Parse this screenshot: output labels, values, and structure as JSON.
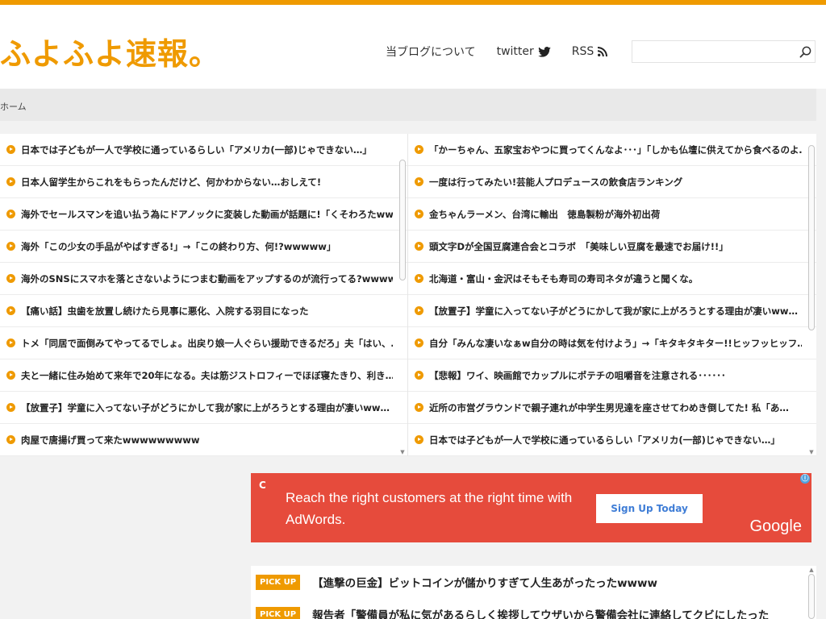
{
  "site": {
    "title": "ふよふよ速報。"
  },
  "colors": {
    "accent": "#ef9a00",
    "ad_background": "#e64b3c",
    "ad_button_text": "#3f7dd6"
  },
  "nav": {
    "about": "当ブログについて",
    "twitter": "twitter",
    "rss": "RSS",
    "search_placeholder": ""
  },
  "breadcrumb": {
    "home": "ホーム"
  },
  "feeds": {
    "left": [
      "日本では子どもが一人で学校に通っているらしい「アメリカ(一部)じゃできない…」",
      "日本人留学生からこれをもらったんだけど、何かわからない…おしえて!",
      "海外でセールスマンを追い払う為にドアノックに変装した動画が話題に!「くそわろたwww",
      "海外「この少女の手品がやばすぎる!」→「この終わり方、何!?wwwww」",
      "海外のSNSにスマホを落とさないようにつまむ動画をアップするのが流行ってる?wwww",
      "【痛い話】虫歯を放置し続けたら見事に悪化、入院する羽目になった",
      "トメ「同居で面倒みてやってるでしょ。出戻り娘一人ぐらい援助できるだろ」夫「はい、…",
      "夫と一緒に住み始めて来年で20年になる。夫は筋ジストロフィーでほぼ寝たきり、利き…",
      "【放置子】学童に入ってない子がどうにかして我が家に上がろうとする理由が凄いww…",
      "肉屋で唐揚げ買って来たwwwwwwwww"
    ],
    "right": [
      "「かーちゃん、五家宝おやつに買ってくんなよ･･･」「しかも仏壇に供えてから食べるのよ…",
      "一度は行ってみたい!芸能人プロデュースの飲食店ランキング",
      "金ちゃんラーメン、台湾に輸出　徳島製粉が海外初出荷",
      "頭文字Dが全国豆腐連合会とコラボ　「美味しい豆腐を最速でお届け!!」",
      "北海道・富山・金沢はそもそも寿司の寿司ネタが違うと聞くな。",
      "【放置子】学童に入ってない子がどうにかして我が家に上がろうとする理由が凄いww…",
      "自分「みんな凄いなぁw自分の時は気を付けよう」→「キタキタキター!!ヒッフッヒッフ…",
      "【悲報】ワイ、映画館でカップルにポテチの咀嚼音を注意される･･････",
      "近所の市営グラウンドで親子連れが中学生男児達を座させてわめき倒してた! 私「あ…",
      "日本では子どもが一人で学校に通っているらしい「アメリカ(一部)じゃできない…」"
    ]
  },
  "ad": {
    "headline": "Reach the right customers at the right time with AdWords.",
    "button": "Sign Up Today",
    "brand": "Google",
    "info": "ⓘ",
    "refresh": "C"
  },
  "pickup": {
    "badge": "PICK UP",
    "items": [
      "【進撃の巨金】ビットコインが儲かりすぎて人生あがったったwwww",
      "報告者「警備員が私に気があるらしく挨拶してウザいから警備会社に連絡してクビにしたった"
    ]
  }
}
